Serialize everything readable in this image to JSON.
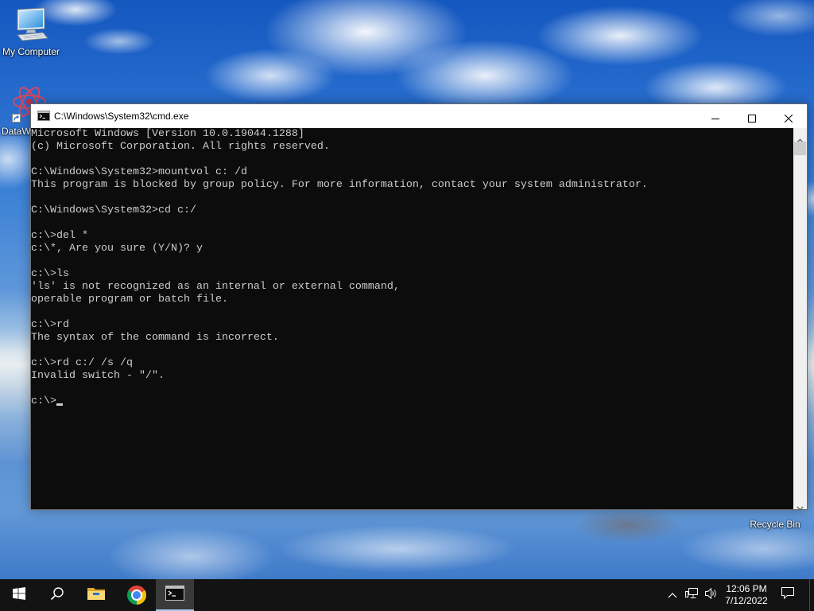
{
  "desktop": {
    "icons": [
      {
        "label": "My Computer",
        "icon": "computer-icon"
      },
      {
        "label": "DataW",
        "icon": "atom-icon"
      },
      {
        "label": "Recycle Bin",
        "icon": "recycle-bin-icon"
      }
    ]
  },
  "window": {
    "title": "C:\\Windows\\System32\\cmd.exe",
    "icon": "terminal-icon",
    "controls": [
      "minimize-icon",
      "maximize-icon",
      "close-icon"
    ],
    "lines": [
      "Microsoft Windows [Version 10.0.19044.1288]",
      "(c) Microsoft Corporation. All rights reserved.",
      "",
      "C:\\Windows\\System32>mountvol c: /d",
      "This program is blocked by group policy. For more information, contact your system administrator.",
      "",
      "C:\\Windows\\System32>cd c:/",
      "",
      "c:\\>del *",
      "c:\\*, Are you sure (Y/N)? y",
      "",
      "c:\\>ls",
      "'ls' is not recognized as an internal or external command,",
      "operable program or batch file.",
      "",
      "c:\\>rd",
      "The syntax of the command is incorrect.",
      "",
      "c:\\>rd c:/ /s /q",
      "Invalid switch - \"/\".",
      ""
    ],
    "prompt": "c:\\>"
  },
  "taskbar": {
    "start_icon": "windows-logo-icon",
    "pinned": [
      {
        "icon": "search-icon",
        "active": false
      },
      {
        "icon": "folder-icon",
        "active": false
      },
      {
        "icon": "chrome-icon",
        "active": false
      },
      {
        "icon": "terminal-icon",
        "active": true
      }
    ],
    "tray": {
      "icons": [
        "chevron-up-icon",
        "network-icon",
        "volume-icon"
      ],
      "clock": {
        "time": "12:06 PM",
        "date": "7/12/2022"
      },
      "notification_icon": "notification-icon"
    }
  },
  "colors": {
    "console_background": "#0c0c0c",
    "console_text": "#cccccc",
    "taskbar": "#131313",
    "titlebar": "#ffffff"
  }
}
